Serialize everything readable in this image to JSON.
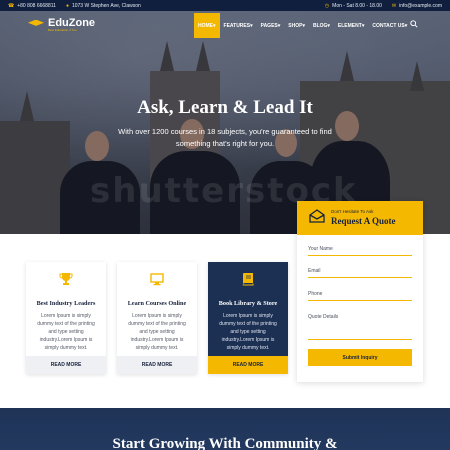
{
  "topbar": {
    "phone": "+80 808 6668811",
    "address": "1073 W Stephen Ave, Clawson",
    "hours": "Mon - Sat 8.00 - 18.00",
    "email": "info@example.com"
  },
  "brand": {
    "name": "EduZone",
    "tagline": "Best Education 4 You",
    "accent": "#f5b800",
    "navy": "#0f1f3d"
  },
  "nav": {
    "items": [
      {
        "label": "HOME",
        "active": true
      },
      {
        "label": "FEATURES",
        "active": false
      },
      {
        "label": "PAGES",
        "active": false
      },
      {
        "label": "SHOP",
        "active": false
      },
      {
        "label": "BLOG",
        "active": false
      },
      {
        "label": "ELEMENT",
        "active": false
      },
      {
        "label": "CONTACT US",
        "active": false
      }
    ],
    "search_icon": "search-icon"
  },
  "hero": {
    "title": "Ask, Learn & Lead It",
    "subtitle": "With over 1200 courses in 18 subjects, you're guaranteed to find something that's right for you.",
    "watermark": "shutterstock"
  },
  "features": [
    {
      "icon": "trophy-icon",
      "title": "Best Industry Leaders",
      "body": "Lorem Ipsum is simply dummy text of the printing and type setting industry.Lorem Ipsum is simply dummy text.",
      "button": "READ MORE"
    },
    {
      "icon": "monitor-icon",
      "title": "Learn Courses Online",
      "body": "Lorem Ipsum is simply dummy text of the printing and type setting industry.Lorem Ipsum is simply dummy text.",
      "button": "READ MORE"
    },
    {
      "icon": "book-icon",
      "title": "Book Library & Store",
      "body": "Lorem Ipsum is simply dummy text of the printing and type setting industry.Lorem Ipsum is simply dummy text.",
      "button": "READ MORE"
    }
  ],
  "quote": {
    "small": "Don't Hesitate To Ask",
    "title": "Request A Quote",
    "fields": [
      {
        "placeholder": "Your Name"
      },
      {
        "placeholder": "Email"
      },
      {
        "placeholder": "Phone"
      },
      {
        "placeholder": "Quote Details"
      }
    ],
    "submit": "Submit Inquiry"
  },
  "band": {
    "title": "Start Growing With Community &"
  }
}
